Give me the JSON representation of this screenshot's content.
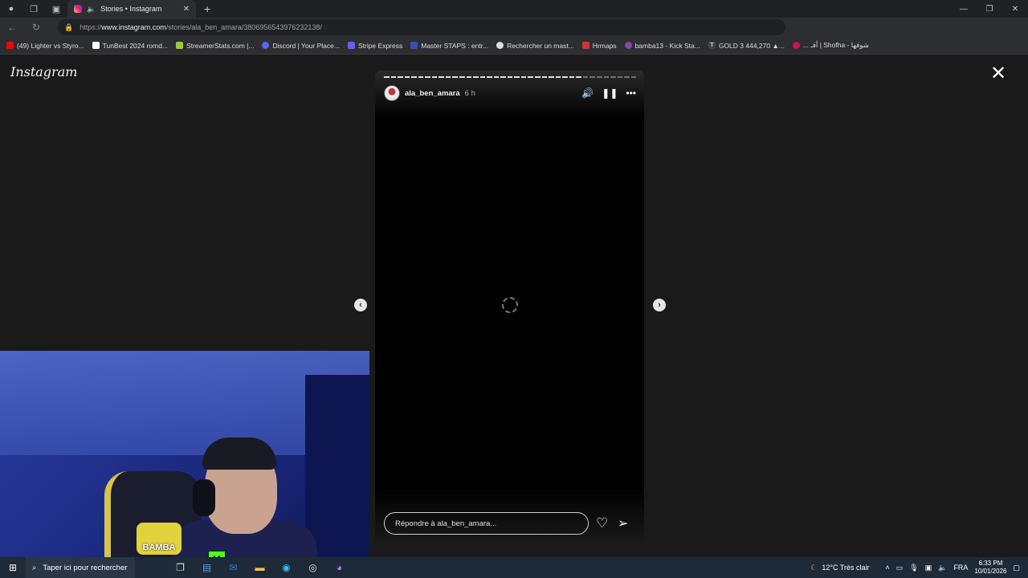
{
  "browser": {
    "tab_title": "Stories • Instagram",
    "url_prefix": "https://",
    "url_domain": "www.instagram.com",
    "url_path": "/stories/ala_ben_amara/3806956543976232138/",
    "bookmarks": [
      {
        "label": "(49) Lighter vs Styro...",
        "color": "#ff0000"
      },
      {
        "label": "TunBest 2024 romd...",
        "color": "#ffffff"
      },
      {
        "label": "StreamerStats.com |...",
        "color": "#9acd32"
      },
      {
        "label": "Discord | Your Place...",
        "color": "#5865f2"
      },
      {
        "label": "Stripe Express",
        "color": "#635bff"
      },
      {
        "label": "Master STAPS : entr...",
        "color": "#3b4cc0"
      },
      {
        "label": "Rechercher un mast...",
        "color": "#dddddd"
      },
      {
        "label": "Hrmaps",
        "color": "#d62f2f"
      },
      {
        "label": "bamba13 - Kick Sta...",
        "color": "#8e44ad"
      },
      {
        "label": "GOLD 3 444,270 ▲...",
        "color": "#222222"
      },
      {
        "label": "... أفـ | Shofha - شوفها",
        "color": "#c2185b"
      }
    ]
  },
  "instagram": {
    "logo": "Instagram",
    "story": {
      "username": "ala_ben_amara",
      "time": "6 h",
      "reply_placeholder": "Répondre à ala_ben_amara..."
    }
  },
  "taskbar": {
    "search_placeholder": "Taper ici pour rechercher",
    "weather": "12°C  Très clair",
    "language": "FRA",
    "time": "6:33 PM",
    "date": "10/01/2026"
  },
  "webcam": {
    "badge_text": "BAMBA",
    "kick_letter": "K"
  }
}
